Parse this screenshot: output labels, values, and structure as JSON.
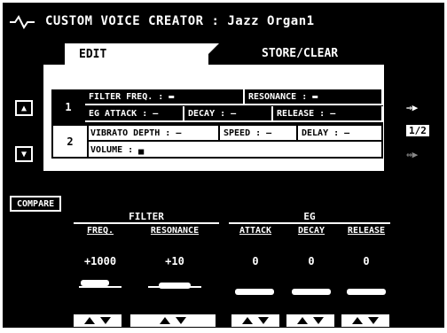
{
  "title": {
    "label": "CUSTOM VOICE CREATOR : Jazz Organ1"
  },
  "tabs": {
    "edit": "EDIT",
    "store_clear": "STORE/CLEAR"
  },
  "page_indicator": "1/2",
  "rows": {
    "row1": {
      "number": "1",
      "filter_freq": "FILTER FREQ. : ▬",
      "resonance": "RESONANCE : ▬",
      "eg_attack": "EG ATTACK : —",
      "decay": "DECAY : —",
      "release": "RELEASE : —"
    },
    "row2": {
      "number": "2",
      "vibrato_depth": "VIBRATO DEPTH : —",
      "speed": "SPEED : —",
      "delay": "DELAY : —",
      "volume": "VOLUME : ▄"
    }
  },
  "compare": "COMPARE",
  "filter": {
    "section_label": "FILTER",
    "freq_label": "FREQ.",
    "resonance_label": "RESONANCE",
    "freq_value": "+1000",
    "resonance_value": "+10"
  },
  "eg": {
    "section_label": "EG",
    "attack_label": "ATTACK",
    "decay_label": "DECAY",
    "release_label": "RELEASE",
    "attack_value": "0",
    "decay_value": "0",
    "release_value": "0"
  },
  "colors": {
    "background": "#000000",
    "foreground": "#ffffff"
  }
}
